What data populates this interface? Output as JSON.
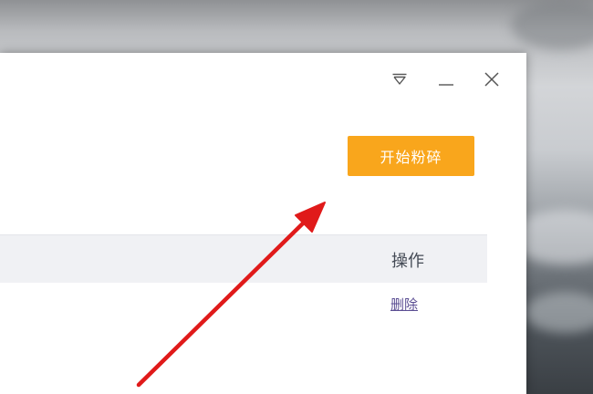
{
  "window": {
    "controls": {
      "menu_icon": "dropdown-triangle-icon",
      "minimize_icon": "minimize-icon",
      "close_icon": "close-icon"
    },
    "start_button_label": "开始粉碎",
    "table": {
      "column_ops": "操作",
      "row_action": "删除"
    }
  },
  "colors": {
    "accent_button": "#f9a61c",
    "annotation_arrow": "#e01a1a",
    "link": "#5b4e93"
  }
}
